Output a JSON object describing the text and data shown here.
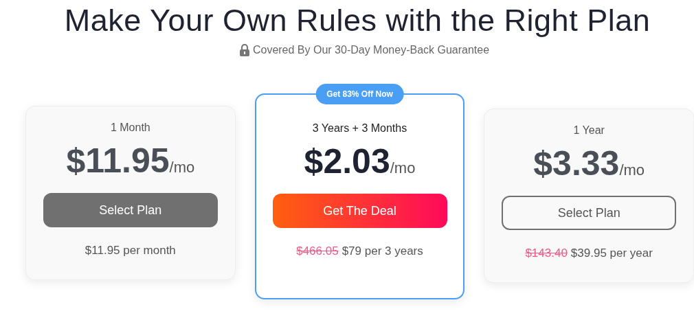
{
  "title": "Make Your Own Rules with the Right Plan",
  "subtitle": "Covered By Our 30-Day Money-Back Guarantee",
  "plans": [
    {
      "name": "1 Month",
      "price": "$11.95",
      "unit": "/mo",
      "button": {
        "label": "Select Plan",
        "kind": "filled"
      },
      "featured": false,
      "billing": "$11.95 per month"
    },
    {
      "badge": "Get 83% Off Now",
      "name": "3 Years + 3 Months",
      "price": "$2.03",
      "unit": "/mo",
      "button": {
        "label": "Get The Deal",
        "kind": "gradient"
      },
      "featured": true,
      "old_price": "$466.05",
      "billing": "$79 per 3 years"
    },
    {
      "name": "1 Year",
      "price": "$3.33",
      "unit": "/mo",
      "button": {
        "label": "Select Plan",
        "kind": "outline"
      },
      "featured": false,
      "old_price": "$143.40",
      "billing": "$39.95 per year"
    }
  ]
}
